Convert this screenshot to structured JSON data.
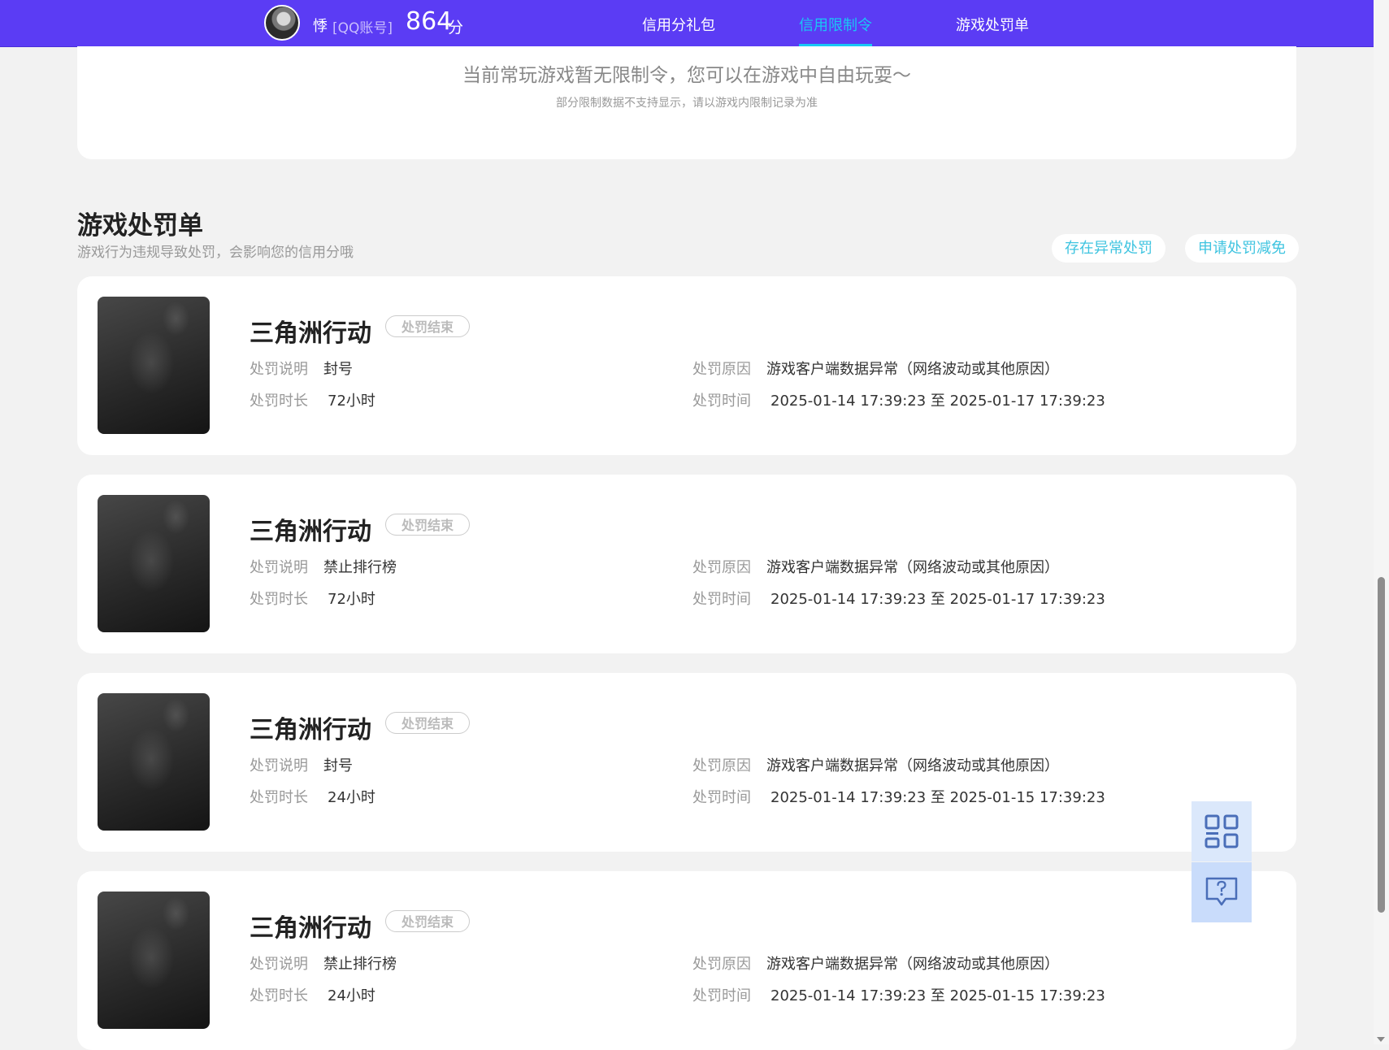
{
  "header": {
    "username": "悸",
    "account_type": "[QQ账号]",
    "score": "864",
    "score_unit": "分",
    "tabs": [
      {
        "label": "信用分礼包",
        "active": false
      },
      {
        "label": "信用限制令",
        "active": true
      },
      {
        "label": "游戏处罚单",
        "active": false
      }
    ]
  },
  "notice": {
    "message": "当前常玩游戏暂无限制令，您可以在游戏中自由玩耍～",
    "sub": "部分限制数据不支持显示，请以游戏内限制记录为准"
  },
  "penalty_section": {
    "title": "游戏处罚单",
    "description": "游戏行为违规导致处罚，会影响您的信用分哦",
    "btn_abnormal": "存在异常处罚",
    "btn_appeal": "申请处罚减免",
    "labels": {
      "explanation": "处罚说明",
      "duration": "处罚时长",
      "reason": "处罚原因",
      "time": "处罚时间"
    },
    "cards": [
      {
        "game": "三角洲行动",
        "status": "处罚结束",
        "explanation": "封号",
        "duration": "72小时",
        "reason": "游戏客户端数据异常（网络波动或其他原因）",
        "time": "2025-01-14 17:39:23 至 2025-01-17 17:39:23"
      },
      {
        "game": "三角洲行动",
        "status": "处罚结束",
        "explanation": "禁止排行榜",
        "duration": "72小时",
        "reason": "游戏客户端数据异常（网络波动或其他原因）",
        "time": "2025-01-14 17:39:23 至 2025-01-17 17:39:23"
      },
      {
        "game": "三角洲行动",
        "status": "处罚结束",
        "explanation": "封号",
        "duration": "24小时",
        "reason": "游戏客户端数据异常（网络波动或其他原因）",
        "time": "2025-01-14 17:39:23 至 2025-01-15 17:39:23"
      },
      {
        "game": "三角洲行动",
        "status": "处罚结束",
        "explanation": "禁止排行榜",
        "duration": "24小时",
        "reason": "游戏客户端数据异常（网络波动或其他原因）",
        "time": "2025-01-14 17:39:23 至 2025-01-15 17:39:23"
      }
    ]
  },
  "float_tools": {
    "icons": [
      "qr-code-icon",
      "help-chat-icon"
    ]
  },
  "colors": {
    "header_bg": "#5b3cf4",
    "accent": "#19c8f5",
    "link": "#3fc4e0"
  }
}
